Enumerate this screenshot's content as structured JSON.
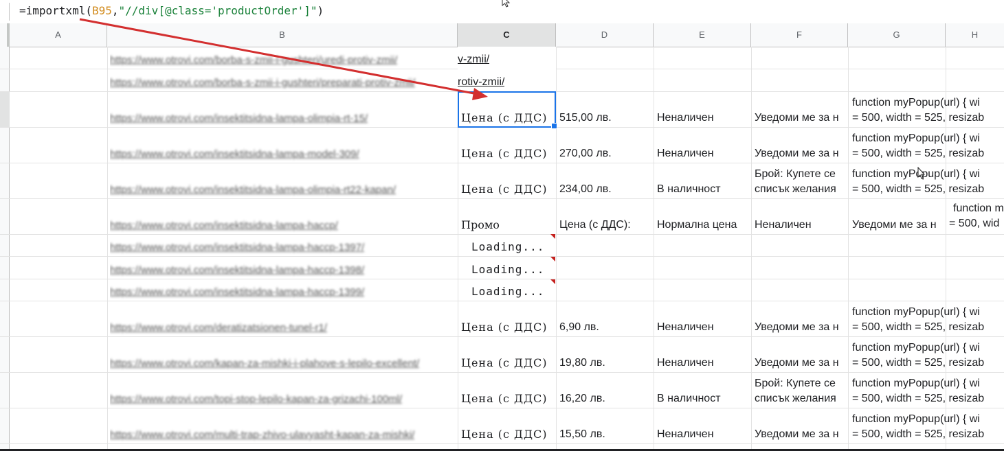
{
  "formula": {
    "prefix": "=importxml(",
    "ref": "B95",
    "comma": ",",
    "arg": "\"//div[@class='productOrder']\"",
    "suffix": ")"
  },
  "columns": [
    "A",
    "B",
    "C",
    "D",
    "E",
    "F",
    "G",
    "H"
  ],
  "rows": [
    {
      "b": "https://www.otrovi.com/borba-s-zmii-i-gushteri/uredi-protiv-zmii/",
      "c_url": "v-zmii/"
    },
    {
      "b": "https://www.otrovi.com/borba-s-zmii-i-gushteri/preparati-protiv-zmii/",
      "c_url": "rotiv-zmii/"
    },
    {
      "b": "https://www.otrovi.com/insektitsidna-lampa-olimpia-rt-15/",
      "c": "Цена (с ДДС)",
      "d": "515,00 лв.",
      "e": "Неналичен",
      "f": "Уведоми ме за н",
      "g1": "function myPopup(url) { wi",
      "g2": "= 500, width = 525, resizab"
    },
    {
      "b": "https://www.otrovi.com/insektitsidna-lampa-model-309/",
      "c": "Цена (с ДДС)",
      "d": "270,00 лв.",
      "e": "Неналичен",
      "f": "Уведоми ме за н",
      "g1": "function myPopup(url) { wi",
      "g2": "= 500, width = 525, resizab"
    },
    {
      "b": "https://www.otrovi.com/insektitsidna-lampa-olimpia-rt22-kapan/",
      "c": "Цена (с ДДС)",
      "d": "234,00 лв.",
      "e": "В наличност",
      "f1": "Брой: Купете се",
      "f2": "списък желания",
      "g1": "function myPopup(url) { wi",
      "g2": "= 500, width = 525, resizab"
    },
    {
      "b": "https://www.otrovi.com/insektitsidna-lampa-haccp/",
      "c": "Промо",
      "d": "Цена (с ДДС):",
      "e": "Нормална цена",
      "f": "Неналичен",
      "g": "Уведоми ме за н",
      "h1": "function m",
      "h2": "= 500, wid"
    },
    {
      "b": "https://www.otrovi.com/insektitsidna-lampa-haccp-1397/",
      "c": "Loading..."
    },
    {
      "b": "https://www.otrovi.com/insektitsidna-lampa-haccp-1398/",
      "c": "Loading..."
    },
    {
      "b": "https://www.otrovi.com/insektitsidna-lampa-haccp-1399/",
      "c": "Loading..."
    },
    {
      "b": "https://www.otrovi.com/deratizatsionen-tunel-r1/",
      "c": "Цена (с ДДС)",
      "d": "6,90 лв.",
      "e": "Неналичен",
      "f": "Уведоми ме за н",
      "g1": "function myPopup(url) { wi",
      "g2": "= 500, width = 525, resizab"
    },
    {
      "b": "https://www.otrovi.com/kapan-za-mishki-i-plahove-s-lepilo-excellent/",
      "c": "Цена (с ДДС)",
      "d": "19,80 лв.",
      "e": "Неналичен",
      "f": "Уведоми ме за н",
      "g1": "function myPopup(url) { wi",
      "g2": "= 500, width = 525, resizab"
    },
    {
      "b": "https://www.otrovi.com/topi-stop-lepilo-kapan-za-grizachi-100ml/",
      "c": "Цена (с ДДС)",
      "d": "16,20 лв.",
      "e": "В наличност",
      "f1": "Брой: Купете се",
      "f2": "списък желания",
      "g1": "function myPopup(url) { wi",
      "g2": "= 500, width = 525, resizab"
    },
    {
      "b": "https://www.otrovi.com/multi-trap-zhivo-ulavyasht-kapan-za-mishki/",
      "c": "Цена (с ДДС)",
      "d": "15,50 лв.",
      "e": "Неналичен",
      "f": "Уведоми ме за н",
      "g1": "function myPopup(url) { wi",
      "g2": "= 500, width = 525, resizab"
    }
  ],
  "colors": {
    "selection": "#1a73e8",
    "arrow": "#d32f2f",
    "comment_flag": "#c5221f"
  },
  "icons": {
    "mouse_pointer": "arrow-cursor-icon",
    "annotation_arrow": "red-arrow"
  }
}
